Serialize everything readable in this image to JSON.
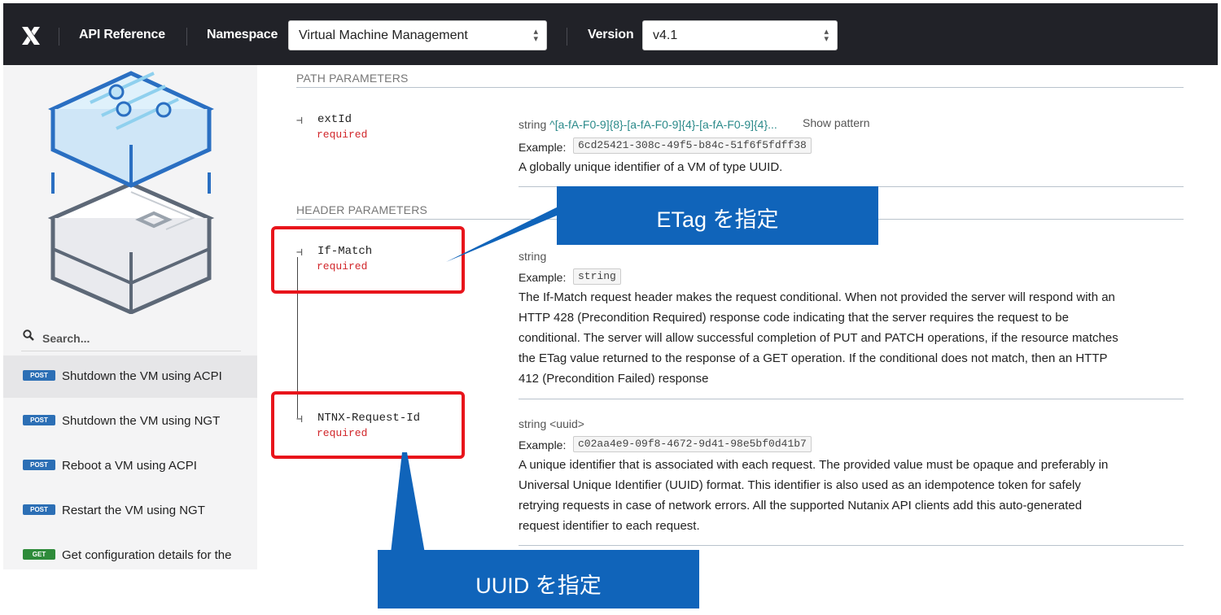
{
  "header": {
    "app_title": "API Reference",
    "namespace_label": "Namespace",
    "namespace_value": "Virtual Machine Management",
    "version_label": "Version",
    "version_value": "v4.1"
  },
  "sidebar": {
    "search_placeholder": "Search...",
    "items": [
      {
        "method": "POST",
        "label": "Shutdown the VM using ACPI",
        "active": true
      },
      {
        "method": "POST",
        "label": "Shutdown the VM using NGT",
        "active": false
      },
      {
        "method": "POST",
        "label": "Reboot a VM using ACPI",
        "active": false
      },
      {
        "method": "POST",
        "label": "Restart the VM using NGT",
        "active": false
      },
      {
        "method": "GET",
        "label": "Get configuration details for the",
        "active": false
      }
    ]
  },
  "path_params": {
    "title": "PATH PARAMETERS",
    "extid": {
      "name": "extId",
      "required": "required",
      "type": "string",
      "pattern": "^[a-fA-F0-9]{8}-[a-fA-F0-9]{4}-[a-fA-F0-9]{4}...",
      "show_pattern": "Show pattern",
      "example_label": "Example:",
      "example": "6cd25421-308c-49f5-b84c-51f6f5fdff38",
      "description": "A globally unique identifier of a VM of type UUID."
    }
  },
  "header_params": {
    "title": "HEADER PARAMETERS",
    "if_match": {
      "name": "If-Match",
      "required": "required",
      "type": "string",
      "example_label": "Example:",
      "example": "string",
      "description_lines": [
        "The If-Match request header makes the request conditional. When not provided the server will respond with an",
        "HTTP 428 (Precondition Required) response code indicating that the server requires the request to be",
        "conditional. The server will allow successful completion of PUT and PATCH operations, if the resource matches",
        "the ETag value returned to the response of a GET operation. If the conditional does not match, then an HTTP",
        "412 (Precondition Failed) response"
      ]
    },
    "request_id": {
      "name": "NTNX-Request-Id",
      "required": "required",
      "type": "string <uuid>",
      "example_label": "Example:",
      "example": "c02aa4e9-09f8-4672-9d41-98e5bf0d41b7",
      "description_lines": [
        "A unique identifier that is associated with each request. The provided value must be opaque and preferably in",
        "Universal Unique Identifier (UUID) format. This identifier is also used as an idempotence token for safely",
        "retrying requests in case of network errors. All the supported Nutanix API clients add this auto-generated",
        "request identifier to each request."
      ]
    }
  },
  "annotations": {
    "etag_callout": "ETag を指定",
    "uuid_callout": "UUID を指定"
  },
  "colors": {
    "topbar": "#212228",
    "highlight_red": "#e8141b",
    "callout_blue": "#1064ba",
    "pattern_teal": "#2b8a8a",
    "required_red": "#d1262a"
  }
}
